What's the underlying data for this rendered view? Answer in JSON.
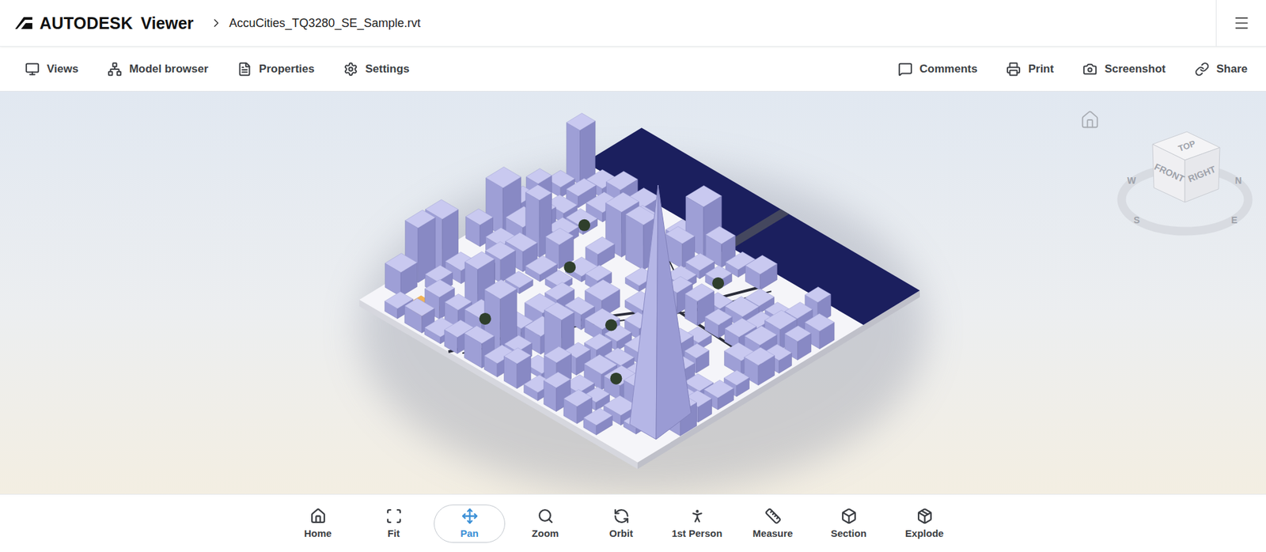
{
  "header": {
    "brand": "AUTODESK",
    "product": "Viewer",
    "file": "AccuCities_TQ3280_SE_Sample.rvt"
  },
  "toolbar": {
    "left": [
      "Views",
      "Model browser",
      "Properties",
      "Settings"
    ],
    "right": [
      "Comments",
      "Print",
      "Screenshot",
      "Share"
    ]
  },
  "viewcube": {
    "faces": [
      "TOP",
      "FRONT",
      "RIGHT"
    ],
    "compass": [
      "W",
      "N",
      "S",
      "E"
    ]
  },
  "tools": [
    {
      "label": "Home",
      "selected": false
    },
    {
      "label": "Fit",
      "selected": false
    },
    {
      "label": "Pan",
      "selected": true
    },
    {
      "label": "Zoom",
      "selected": false
    },
    {
      "label": "Orbit",
      "selected": false
    },
    {
      "label": "1st Person",
      "selected": false
    },
    {
      "label": "Measure",
      "selected": false
    },
    {
      "label": "Section",
      "selected": false
    },
    {
      "label": "Explode",
      "selected": false
    }
  ]
}
